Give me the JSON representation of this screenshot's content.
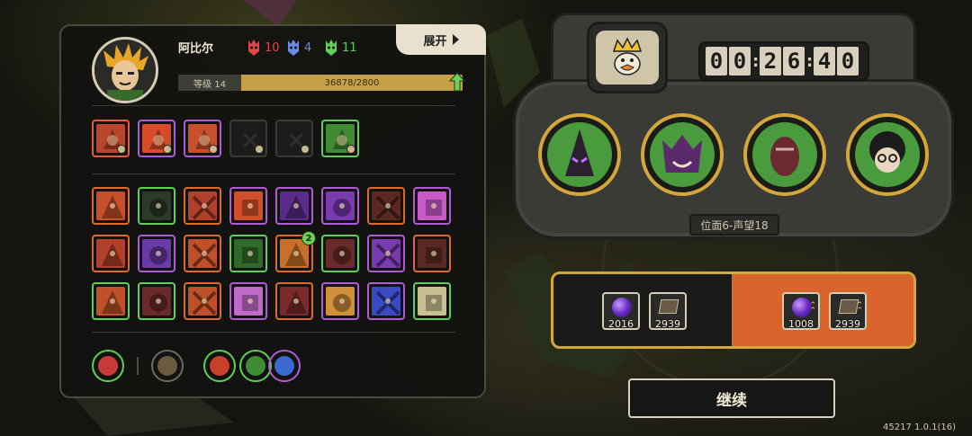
{
  "player": {
    "name": "阿比尔",
    "level_label": "等级 14",
    "xp_text": "36878/2800",
    "avatar_icon": "spiky-hair-hero-avatar"
  },
  "expand_button": {
    "label": "展开"
  },
  "resources": [
    {
      "icon": "red-mask-icon",
      "value": "10",
      "color": "#e04848"
    },
    {
      "icon": "blue-mask-icon",
      "value": "4",
      "color": "#6c8ce8"
    },
    {
      "icon": "green-mask-icon",
      "value": "11",
      "color": "#5fcf5a"
    }
  ],
  "equipped_skills": [
    {
      "icon": "fist-skill-icon",
      "border": "#e85b3a",
      "fill": "#b9462a",
      "empty": false,
      "corner": true
    },
    {
      "icon": "flame-skill-icon",
      "border": "#b15ad6",
      "fill": "#d84a2a",
      "empty": false,
      "corner": true
    },
    {
      "icon": "punch-skill-icon",
      "border": "#b15ad6",
      "fill": "#c8502c",
      "empty": false,
      "corner": true
    },
    {
      "icon": "empty-slot-icon",
      "border": "#3a3a36",
      "fill": "#1c1c1a",
      "empty": true,
      "corner": true
    },
    {
      "icon": "empty-slot-icon",
      "border": "#3a3a36",
      "fill": "#1c1c1a",
      "empty": true,
      "corner": true
    },
    {
      "icon": "vine-skill-icon",
      "border": "#5fcf5a",
      "fill": "#3f8a34",
      "empty": false,
      "corner": true
    }
  ],
  "relics": [
    {
      "icon": "claw-relic-icon",
      "border": "#e06a2a",
      "fill": "#c5502a"
    },
    {
      "icon": "hooded-figure-relic-icon",
      "border": "#5fcf5a",
      "fill": "#2d3a2a"
    },
    {
      "icon": "dual-claw-relic-icon",
      "border": "#e06a2a",
      "fill": "#b2402a"
    },
    {
      "icon": "target-relic-icon",
      "border": "#b15ad6",
      "fill": "#d0502c"
    },
    {
      "icon": "crescent-relic-icon",
      "border": "#b15ad6",
      "fill": "#5a2c8a"
    },
    {
      "icon": "skull-mage-relic-icon",
      "border": "#b15ad6",
      "fill": "#7a3ab0"
    },
    {
      "icon": "demon-face-relic-icon",
      "border": "#e06a2a",
      "fill": "#5a2a22"
    },
    {
      "icon": "spellbook-relic-icon",
      "border": "#b15ad6",
      "fill": "#c85ac8"
    },
    {
      "icon": "crossed-blades-relic-icon",
      "border": "#e06a2a",
      "fill": "#b2402a"
    },
    {
      "icon": "lightning-sword-relic-icon",
      "border": "#b15ad6",
      "fill": "#6a3aa8"
    },
    {
      "icon": "pointing-hand-relic-icon",
      "border": "#e06a2a",
      "fill": "#c0502a"
    },
    {
      "icon": "green-flame-relic-icon",
      "border": "#5fcf5a",
      "fill": "#2f6a2a"
    },
    {
      "icon": "drink-relic-icon",
      "border": "#e06a2a",
      "fill": "#c8702a",
      "badge": "2"
    },
    {
      "icon": "horned-skull-relic-icon",
      "border": "#5fcf5a",
      "fill": "#6a2a2a"
    },
    {
      "icon": "chain-link-relic-icon",
      "border": "#b15ad6",
      "fill": "#7a3ab0"
    },
    {
      "icon": "gears-relic-icon",
      "border": "#e06a2a",
      "fill": "#5a2a22"
    },
    {
      "icon": "dagger-relic-icon",
      "border": "#5fcf5a",
      "fill": "#c0502a"
    },
    {
      "icon": "hand-relic-icon",
      "border": "#5fcf5a",
      "fill": "#6a2a2a"
    },
    {
      "icon": "explosion-relic-icon",
      "border": "#e06a2a",
      "fill": "#c0502a"
    },
    {
      "icon": "monster-face-relic-icon",
      "border": "#b15ad6",
      "fill": "#c06ac8"
    },
    {
      "icon": "crack-relic-icon",
      "border": "#e06a2a",
      "fill": "#7a2a2a"
    },
    {
      "icon": "spiral-coin-relic-icon",
      "border": "#b15ad6",
      "fill": "#d0903a"
    },
    {
      "icon": "blue-beast-relic-icon",
      "border": "#b15ad6",
      "fill": "#3a4ac0"
    },
    {
      "icon": "ribcage-relic-icon",
      "border": "#5fcf5a",
      "fill": "#c8c090"
    }
  ],
  "bottom_icons": [
    {
      "icon": "red-gem-emblem-icon",
      "border": "#5fcf5a",
      "fill": "#c83a3a"
    },
    {
      "icon": "beast-emblem-icon",
      "border": "#6a6a60",
      "fill": "#6a5a40"
    },
    {
      "icon": "star-emblem-icon",
      "border": "#5fcf5a",
      "fill": "#c8402a"
    },
    {
      "icon": "flask-emblem-icon",
      "border": "#5fcf5a",
      "fill": "#3f8a34"
    },
    {
      "icon": "swirl-emblem-icon",
      "border": "#b15ad6",
      "fill": "#3a6ad0"
    }
  ],
  "crown_icon": "crowned-duck-icon",
  "timer": {
    "h": "00",
    "m": "26",
    "s": "40"
  },
  "heroes": [
    {
      "icon": "hooded-assassin-portrait-icon",
      "fill": "#4a9a3e"
    },
    {
      "icon": "crowned-demon-portrait-icon",
      "fill": "#4a9a3e"
    },
    {
      "icon": "cocoon-beast-portrait-icon",
      "fill": "#4a9a3e"
    },
    {
      "icon": "glasses-kid-portrait-icon",
      "fill": "#4a9a3e"
    }
  ],
  "stage": {
    "label": "位面6-声望18"
  },
  "rewards": {
    "left": [
      {
        "icon": "purple-orb-icon",
        "value": "2016"
      },
      {
        "icon": "book-icon",
        "value": "2939"
      }
    ],
    "right": [
      {
        "icon": "purple-orb-upgrade-icon",
        "value": "1008"
      },
      {
        "icon": "book-upgrade-icon",
        "value": "2939"
      }
    ]
  },
  "continue_button": {
    "label": "继续"
  },
  "version": "45217 1.0.1(16)",
  "colors": {
    "gold": "#d4a838",
    "orange": "#d9652c",
    "cream": "#e9e1cd"
  }
}
